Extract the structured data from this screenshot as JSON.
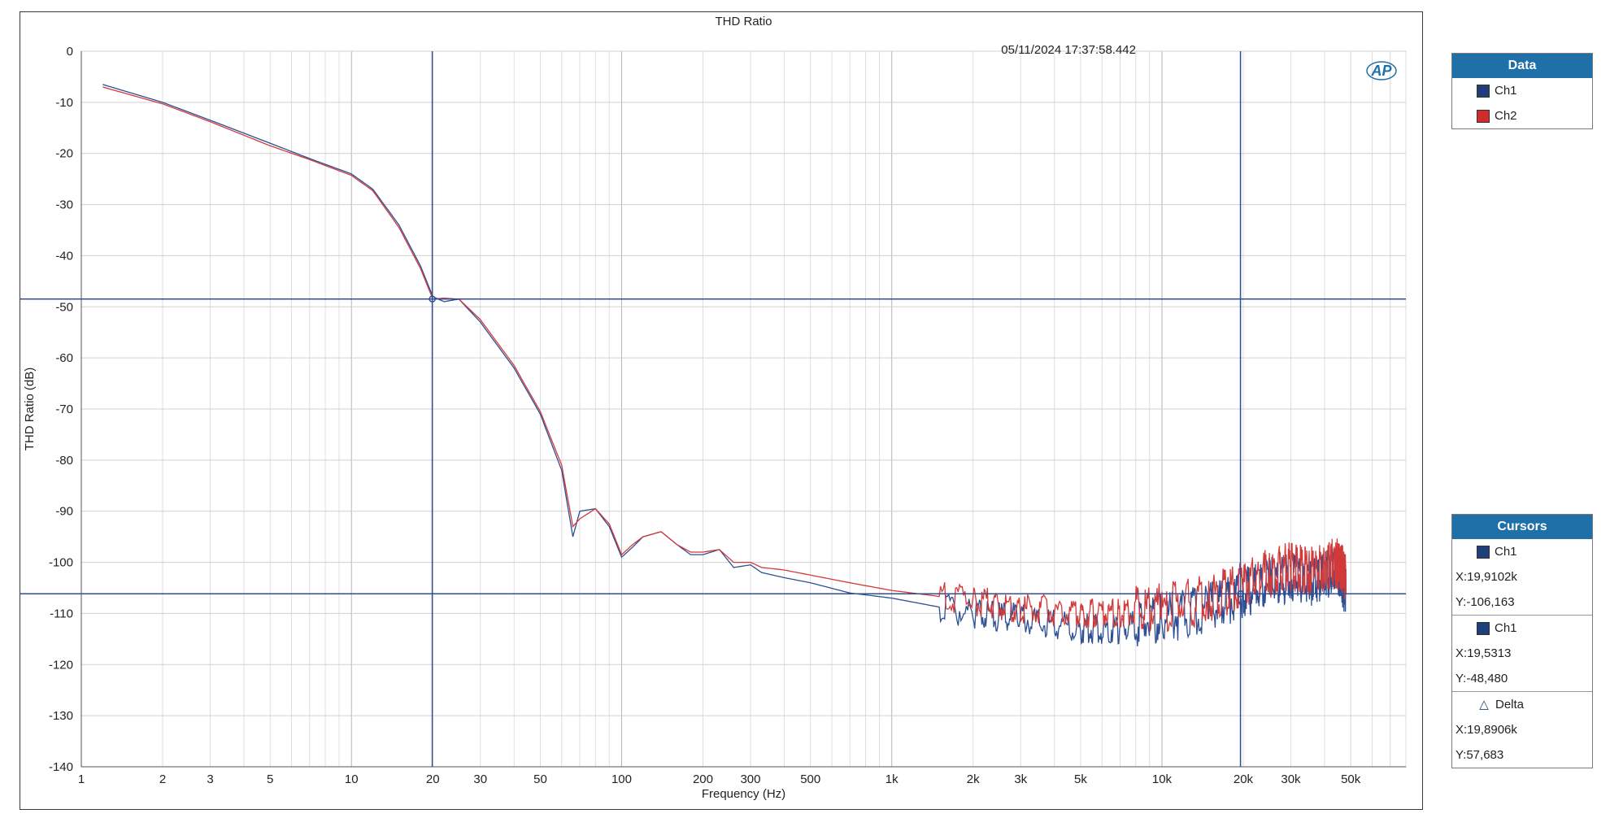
{
  "title": "THD Ratio",
  "timestamp": "05/11/2024 17:37:58.442",
  "chart_data": {
    "type": "line",
    "title": "THD Ratio",
    "xlabel": "Frequency (Hz)",
    "ylabel": "THD Ratio (dB)",
    "xscale": "log",
    "xlim": [
      1,
      80000
    ],
    "ylim": [
      -140,
      0
    ],
    "x_ticks": [
      1,
      2,
      3,
      5,
      10,
      20,
      30,
      50,
      100,
      200,
      300,
      500,
      1000,
      2000,
      3000,
      5000,
      10000,
      20000,
      30000,
      50000
    ],
    "x_tick_labels": [
      "1",
      "2",
      "3",
      "5",
      "10",
      "20",
      "30",
      "50",
      "100",
      "200",
      "300",
      "500",
      "1k",
      "2k",
      "3k",
      "5k",
      "10k",
      "20k",
      "30k",
      "50k"
    ],
    "y_ticks": [
      0,
      -10,
      -20,
      -30,
      -40,
      -50,
      -60,
      -70,
      -80,
      -90,
      -100,
      -110,
      -120,
      -130,
      -140
    ],
    "y_tick_labels": [
      "0",
      "-10",
      "-20",
      "-30",
      "-40",
      "-50",
      "-60",
      "-70",
      "-80",
      "-90",
      "-100",
      "-110",
      "-120",
      "-130",
      "-140"
    ],
    "grid": true,
    "legend_position": "right",
    "series": [
      {
        "name": "Ch1",
        "color": "#2e4f94",
        "x": [
          1.2,
          2,
          3,
          5,
          7,
          10,
          12,
          15,
          18,
          20,
          22,
          25,
          30,
          40,
          50,
          60,
          66,
          70,
          80,
          90,
          100,
          110,
          120,
          140,
          160,
          180,
          200,
          230,
          260,
          300,
          330,
          400,
          500,
          700,
          1000,
          2000,
          3000,
          5000,
          7000,
          10000,
          15000,
          20000,
          25000,
          30000,
          35000,
          40000,
          44000,
          46000,
          48000
        ],
        "y": [
          -6.5,
          -10,
          -13.5,
          -18,
          -21,
          -24,
          -27,
          -34,
          -42,
          -48,
          -49,
          -48.5,
          -53,
          -62,
          -71,
          -82,
          -95,
          -90,
          -89.5,
          -93,
          -99,
          -97,
          -95,
          -94,
          -96.5,
          -98.5,
          -98.5,
          -97.5,
          -101,
          -100.5,
          -102,
          -103,
          -104,
          -106,
          -107,
          -110,
          -111,
          -113,
          -113,
          -111,
          -109,
          -106,
          -104,
          -103,
          -104,
          -103,
          -101,
          -103,
          -106
        ]
      },
      {
        "name": "Ch2",
        "color": "#d23a3a",
        "x": [
          1.2,
          2,
          3,
          5,
          7,
          10,
          12,
          15,
          18,
          20,
          22,
          25,
          30,
          40,
          50,
          60,
          66,
          70,
          80,
          90,
          100,
          110,
          120,
          140,
          160,
          180,
          200,
          230,
          260,
          300,
          330,
          400,
          500,
          700,
          1000,
          2000,
          3000,
          5000,
          7000,
          10000,
          15000,
          20000,
          25000,
          30000,
          35000,
          40000,
          44000,
          46000,
          48000
        ],
        "y": [
          -7,
          -10.3,
          -13.8,
          -18.5,
          -21.2,
          -24.3,
          -27.3,
          -34.5,
          -42.5,
          -48.5,
          -48.3,
          -48.5,
          -52.5,
          -61.5,
          -70.5,
          -81,
          -93,
          -91.5,
          -89.5,
          -92.5,
          -98.5,
          -96.5,
          -95,
          -94,
          -96.5,
          -98,
          -98,
          -97.5,
          -100,
          -100,
          -101,
          -101.5,
          -102.5,
          -104,
          -105.5,
          -107.5,
          -109,
          -110,
          -110,
          -109,
          -107,
          -104,
          -102,
          -101,
          -102,
          -101,
          -100,
          -101,
          -103
        ]
      }
    ],
    "cursors": {
      "x_values": [
        19.9102,
        19531.3
      ],
      "y_values": [
        -106.163,
        -48.48
      ]
    }
  },
  "legend": {
    "header": "Data",
    "items": [
      {
        "label": "Ch1",
        "color": "#1f3f7a"
      },
      {
        "label": "Ch2",
        "color": "#d02a2a"
      }
    ]
  },
  "cursors_panel": {
    "header": "Cursors",
    "cursor1": {
      "label": "Ch1",
      "x": "X:19,9102k",
      "y": "Y:-106,163"
    },
    "cursor2": {
      "label": "Ch1",
      "x": "X:19,5313",
      "y": "Y:-48,480"
    },
    "delta": {
      "label": "Delta",
      "x": "X:19,8906k",
      "y": "Y:57,683"
    }
  },
  "logo": "AP"
}
